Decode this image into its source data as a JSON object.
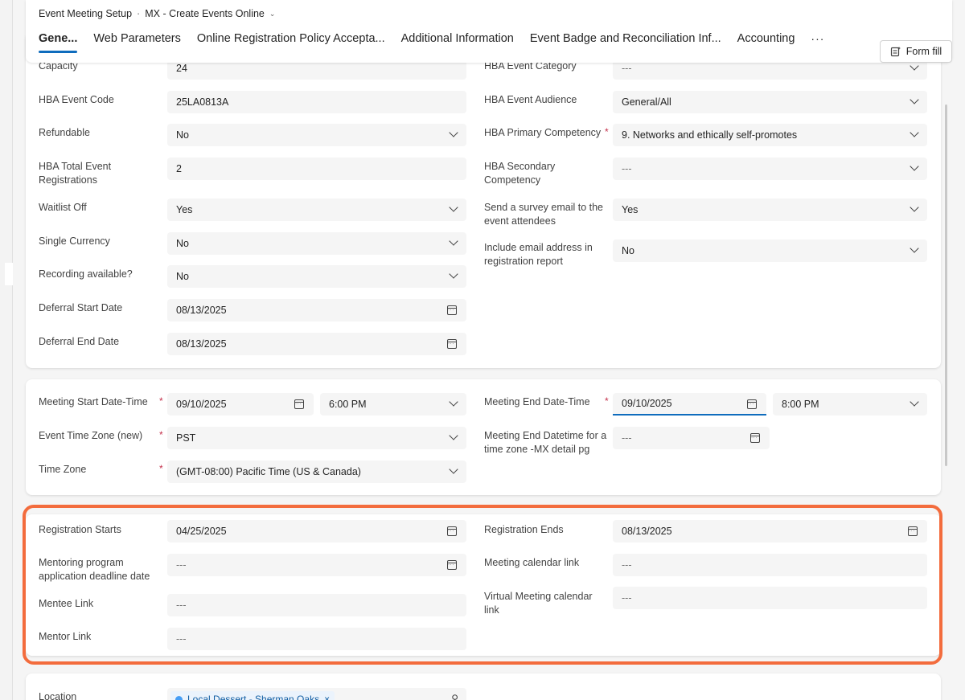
{
  "header": {
    "form_name": "Event Meeting Setup",
    "separator": "·",
    "record_title": "MX - Create Events Online",
    "tabs": [
      "Gene...",
      "Web Parameters",
      "Online Registration Policy Accepta...",
      "Additional Information",
      "Event Badge and Reconciliation Inf...",
      "Accounting"
    ],
    "more_tabs": "···",
    "form_fill_label": "Form fill"
  },
  "section1": {
    "left": [
      {
        "label": "Capacity",
        "value": "24"
      },
      {
        "label": "HBA Event Code",
        "value": "25LA0813A"
      },
      {
        "label": "Refundable",
        "value": "No"
      },
      {
        "label": "HBA Total Event Registrations",
        "value": "2"
      },
      {
        "label": "Waitlist Off",
        "value": "Yes"
      },
      {
        "label": "Single Currency",
        "value": "No"
      },
      {
        "label": "Recording available?",
        "value": "No"
      },
      {
        "label": "Deferral Start Date",
        "value": "08/13/2025"
      },
      {
        "label": "Deferral End Date",
        "value": "08/13/2025"
      }
    ],
    "right": [
      {
        "label": "HBA Event Category",
        "value": "---"
      },
      {
        "label": "HBA Event Audience",
        "value": "General/All"
      },
      {
        "label": "HBA Primary Competency",
        "value": "9. Networks and ethically self-promotes"
      },
      {
        "label": "HBA Secondary Competency",
        "value": "---"
      },
      {
        "label": "Send a survey email to the event attendees",
        "value": "Yes"
      },
      {
        "label": "Include email address in registration report",
        "value": "No"
      }
    ]
  },
  "section2": {
    "meeting_start_label": "Meeting Start Date-Time",
    "meeting_start_date": "09/10/2025",
    "meeting_start_time": "6:00 PM",
    "meeting_end_label": "Meeting End Date-Time",
    "meeting_end_date": "09/10/2025",
    "meeting_end_time": "8:00 PM",
    "time_zone_new_label": "Event Time Zone (new)",
    "time_zone_new_value": "PST",
    "end_datetime_mx_label": "Meeting End Datetime for a time zone -MX detail pg",
    "end_datetime_mx_value": "---",
    "time_zone_label": "Time Zone",
    "time_zone_value": "(GMT-08:00) Pacific Time (US & Canada)"
  },
  "section3": {
    "registration_starts_label": "Registration Starts",
    "registration_starts_value": "04/25/2025",
    "registration_ends_label": "Registration Ends",
    "registration_ends_value": "08/13/2025",
    "mentoring_deadline_label": "Mentoring program application deadline date",
    "mentoring_deadline_value": "---",
    "meeting_calendar_link_label": "Meeting calendar link",
    "meeting_calendar_link_value": "---",
    "mentee_link_label": "Mentee Link",
    "mentee_link_value": "---",
    "virtual_calendar_link_label": "Virtual Meeting calendar link",
    "virtual_calendar_link_value": "---",
    "mentor_link_label": "Mentor Link",
    "mentor_link_value": "---"
  },
  "section4": {
    "location_label": "Location",
    "location_value": "Local Dessert - Sherman Oaks"
  },
  "colors": {
    "accent": "#0f6cbd",
    "required": "#c4314b",
    "highlight": "#f36c3d"
  }
}
